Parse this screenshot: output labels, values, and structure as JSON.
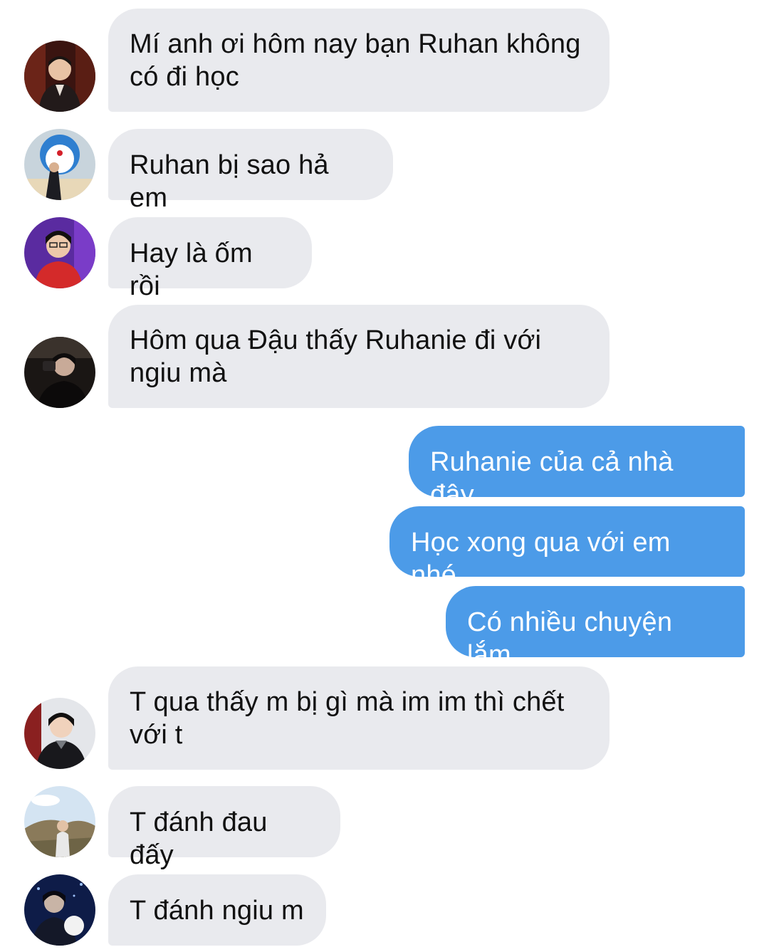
{
  "conversation": {
    "messages": [
      {
        "sender": "incoming",
        "text": "Mí anh ơi hôm nay bạn Ruhan không\ncó đi học"
      },
      {
        "sender": "incoming",
        "text": "Ruhan bị sao hả em"
      },
      {
        "sender": "incoming",
        "text": "Hay là ốm rồi"
      },
      {
        "sender": "incoming",
        "text": "Hôm qua Đậu thấy Ruhanie đi với\nngiu mà"
      },
      {
        "sender": "outgoing",
        "text": "Ruhanie của cả nhà đây"
      },
      {
        "sender": "outgoing",
        "text": "Học xong qua với em nhé"
      },
      {
        "sender": "outgoing",
        "text": "Có nhiều chuyện lắm"
      },
      {
        "sender": "incoming",
        "text": "T qua thấy m bị gì mà im im thì chết\nvới t"
      },
      {
        "sender": "incoming",
        "text": "T đánh đau đấy"
      },
      {
        "sender": "incoming",
        "text": "T đánh ngiu m"
      }
    ]
  },
  "colors": {
    "incoming_bubble": "#e9eaee",
    "outgoing_bubble": "#4c9be8",
    "incoming_text": "#111111",
    "outgoing_text": "#ffffff"
  }
}
